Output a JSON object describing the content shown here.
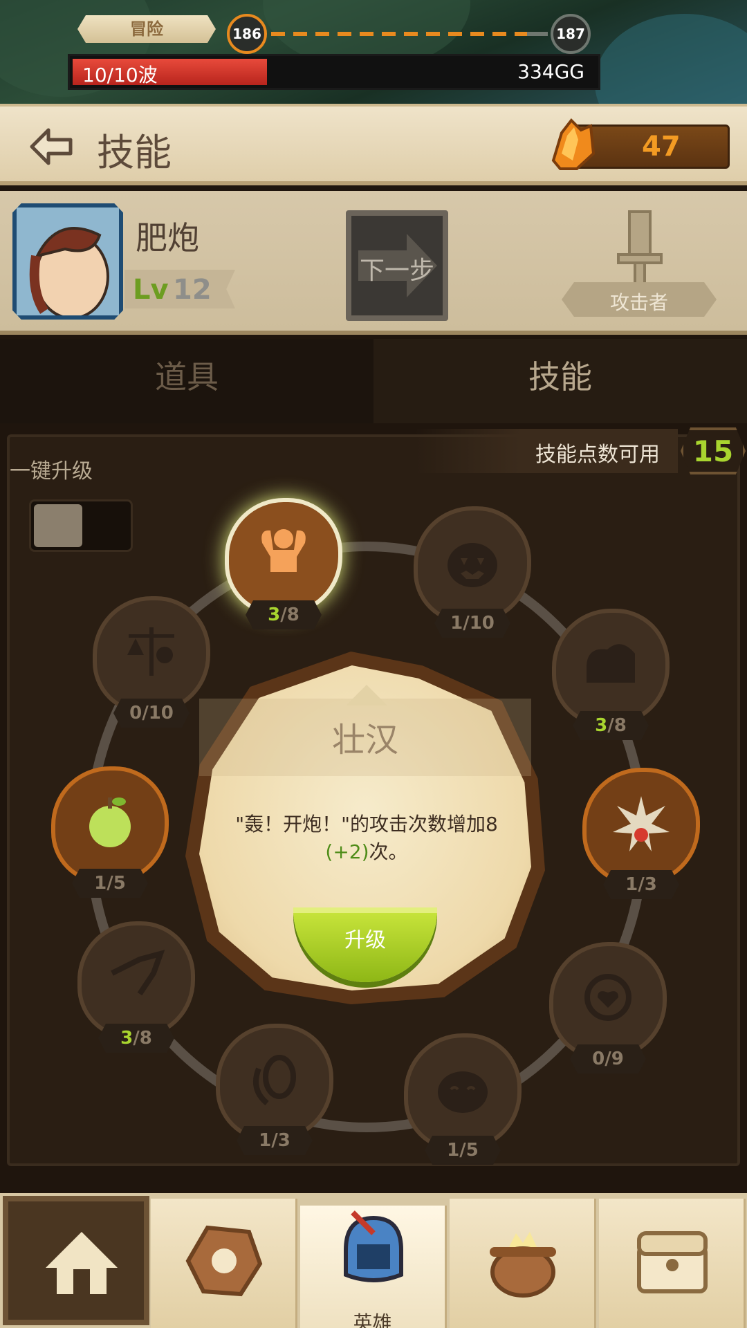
{
  "top_bar": {
    "mode_label": "冒险",
    "current_stage": "186",
    "next_stage": "187",
    "wave_text": "10/10波",
    "wave_progress": 0.37,
    "gold_text": "334GG"
  },
  "header": {
    "title": "技能",
    "crystals": "47"
  },
  "hero": {
    "name": "肥炮",
    "lv_prefix": "Lv",
    "level": "12",
    "next_step_label": "下一步",
    "role": "攻击者"
  },
  "tabs": {
    "items": "道具",
    "skills": "技能"
  },
  "skill_panel": {
    "points_label": "技能点数可用",
    "points_value": "15",
    "one_key_label": "一键升级",
    "one_key_enabled": false,
    "nodes": [
      {
        "icon": "strongman-icon",
        "current": "3",
        "max": "/8",
        "state": "active"
      },
      {
        "icon": "pumpkin-icon",
        "current": "1",
        "max": "/10",
        "state": "normal"
      },
      {
        "icon": "cloud-icon",
        "current": "3",
        "max": "/8",
        "state": "normal"
      },
      {
        "icon": "explosion-icon",
        "current": "1",
        "max": "/3",
        "state": "upgradeable"
      },
      {
        "icon": "heart-target-icon",
        "current": "0",
        "max": "/9",
        "state": "normal"
      },
      {
        "icon": "happy-face-icon",
        "current": "1",
        "max": "/5",
        "state": "normal"
      },
      {
        "icon": "rotate-egg-icon",
        "current": "1",
        "max": "/3",
        "state": "normal"
      },
      {
        "icon": "broken-arrow-icon",
        "current": "3",
        "max": "/8",
        "state": "normal"
      },
      {
        "icon": "apple-icon",
        "current": "1",
        "max": "/5",
        "state": "upgradeable"
      },
      {
        "icon": "scales-icon",
        "current": "0",
        "max": "/10",
        "state": "normal"
      }
    ]
  },
  "popup": {
    "title": "壮汉",
    "desc_main": "\"轰！开炮！\"的攻击次数增加8",
    "desc_bonus": "(+2)",
    "desc_tail": "次。",
    "button_label": "升级"
  },
  "bottom_nav": {
    "heroes_label": "英雄",
    "items": [
      "home-icon",
      "rune-icon",
      "hero-helmet-icon",
      "cauldron-icon",
      "chest-icon"
    ]
  },
  "colors": {
    "accent_orange": "#e88a1f",
    "level_green": "#a9d52f",
    "crystal_orange": "#f39b23",
    "wave_red": "#d63a2e"
  }
}
